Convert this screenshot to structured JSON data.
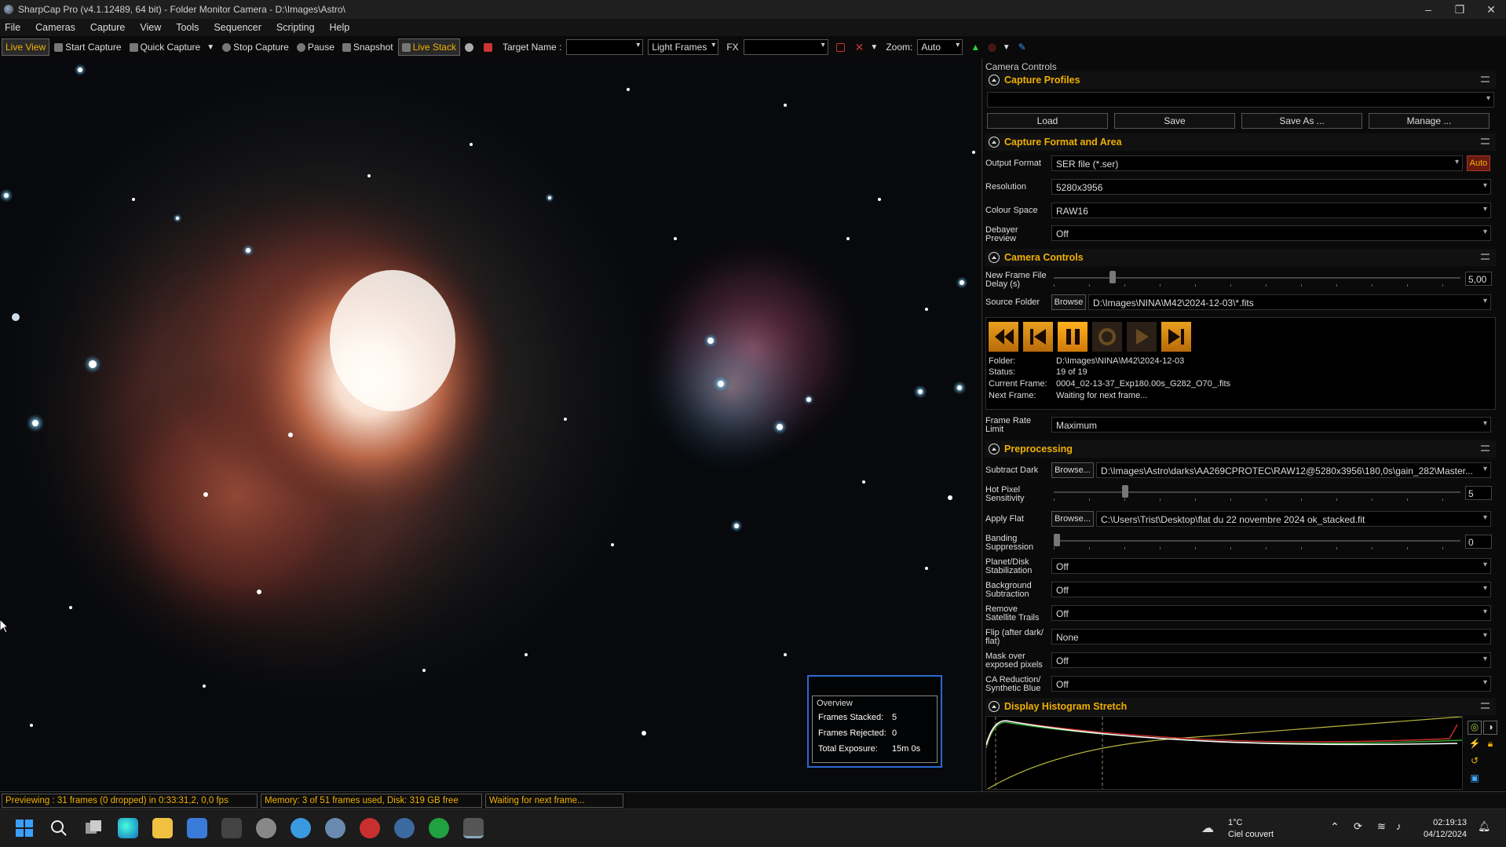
{
  "window": {
    "title": "SharpCap Pro (v4.1.12489, 64 bit) - Folder Monitor Camera - D:\\Images\\Astro\\"
  },
  "menu": [
    "File",
    "Cameras",
    "Capture",
    "View",
    "Tools",
    "Sequencer",
    "Scripting",
    "Help"
  ],
  "toolbar": {
    "live_view": "Live View",
    "start_capture": "Start Capture",
    "quick_capture": "Quick Capture",
    "stop_capture": "Stop Capture",
    "pause": "Pause",
    "snapshot": "Snapshot",
    "live_stack": "Live Stack",
    "target_name_label": "Target Name :",
    "target_name_value": "",
    "frame_type": "Light Frames",
    "fx_label": "FX",
    "fx_value": "",
    "zoom_label": "Zoom:",
    "zoom_value": "Auto"
  },
  "overview": {
    "title": "Overview",
    "frames_stacked_label": "Frames Stacked:",
    "frames_stacked": "5",
    "frames_rejected_label": "Frames Rejected:",
    "frames_rejected": "0",
    "total_exposure_label": "Total Exposure:",
    "total_exposure": "15m 0s"
  },
  "panel": {
    "title": "Camera Controls",
    "capture_profiles": {
      "title": "Capture Profiles",
      "profile": "",
      "load": "Load",
      "save": "Save",
      "save_as": "Save As ...",
      "manage": "Manage ..."
    },
    "format": {
      "title": "Capture Format and Area",
      "output_format_label": "Output Format",
      "output_format": "SER file (*.ser)",
      "auto": "Auto",
      "resolution_label": "Resolution",
      "resolution": "5280x3956",
      "colour_space_label": "Colour Space",
      "colour_space": "RAW16",
      "debayer_label1": "Debayer",
      "debayer_label2": "Preview",
      "debayer": "Off"
    },
    "camera": {
      "title": "Camera Controls",
      "delay_label1": "New Frame File",
      "delay_label2": "Delay (s)",
      "delay_value": "5,00",
      "delay_fraction": 0.14,
      "source_label": "Source Folder",
      "browse": "Browse",
      "source_path": "D:\\Images\\NINA\\M42\\2024-12-03\\*.fits",
      "folder_label": "Folder:",
      "folder": "D:\\Images\\NINA\\M42\\2024-12-03",
      "status_label": "Status:",
      "status": "19 of 19",
      "current_label": "Current Frame:",
      "current": "0004_02-13-37_Exp180.00s_G282_O70_.fits",
      "next_label": "Next Frame:",
      "next": "Waiting for next frame...",
      "rate_label1": "Frame Rate",
      "rate_label2": "Limit",
      "rate": "Maximum"
    },
    "pre": {
      "title": "Preprocessing",
      "dark_label": "Subtract Dark",
      "dark_browse": "Browse...",
      "dark_path": "D:\\Images\\Astro\\darks\\AA269CPROTEC\\RAW12@5280x3956\\180,0s\\gain_282\\Master...",
      "hot_label1": "Hot Pixel",
      "hot_label2": "Sensitivity",
      "hot_value": "5",
      "hot_fraction": 0.17,
      "flat_label": "Apply Flat",
      "flat_browse": "Browse...",
      "flat_path": "C:\\Users\\Trist\\Desktop\\flat du 22 novembre 2024 ok_stacked.fit",
      "band_label1": "Banding",
      "band_label2": "Suppression",
      "band_value": "0",
      "band_fraction": 0.0,
      "planet_label1": "Planet/Disk",
      "planet_label2": "Stabilization",
      "planet": "Off",
      "bg_label1": "Background",
      "bg_label2": "Subtraction",
      "bg": "Off",
      "sat_label1": "Remove",
      "sat_label2": "Satellite Trails",
      "sat": "Off",
      "flip_label1": "Flip (after dark/",
      "flip_label2": "flat)",
      "flip": "None",
      "mask_label1": "Mask over",
      "mask_label2": "exposed pixels",
      "mask": "Off",
      "ca_label1": "CA Reduction/",
      "ca_label2": "Synthetic Blue",
      "ca": "Off"
    },
    "hist": {
      "title": "Display Histogram Stretch"
    }
  },
  "status": {
    "preview": "Previewing : 31 frames (0 dropped) in 0:33:31,2, 0,0 fps",
    "memory": "Memory: 3 of 51 frames used, Disk: 319 GB free",
    "waiting": "Waiting for next frame..."
  },
  "taskbar": {
    "temp": "1°C",
    "weather": "Ciel couvert",
    "time": "02:19:13",
    "date": "04/12/2024"
  },
  "colors": {
    "accent": "#f0b000",
    "panel_bg": "#000000",
    "overview_border": "#2a6ad0"
  }
}
